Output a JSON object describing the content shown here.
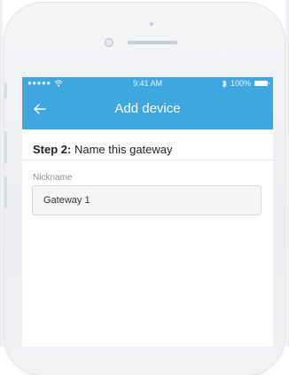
{
  "status_bar": {
    "signal": "●●●●●",
    "time": "9:41 AM",
    "battery": "100%"
  },
  "header": {
    "title": "Add device"
  },
  "step": {
    "prefix": "Step 2:",
    "text": " Name this gateway"
  },
  "nickname": {
    "label": "Nickname",
    "value": "Gateway 1"
  },
  "colors": {
    "accent": "#3fa7df"
  },
  "icons": {
    "back": "arrow-left-icon",
    "wifi": "wifi-icon",
    "bluetooth": "bluetooth-icon",
    "battery": "battery-icon"
  }
}
